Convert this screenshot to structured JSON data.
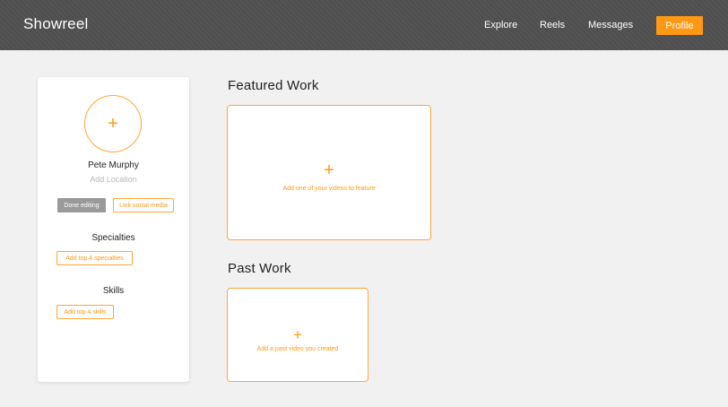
{
  "header": {
    "brand": "Showreel",
    "nav": {
      "explore": "Explore",
      "reels": "Reels",
      "messages": "Messages",
      "profile": "Profile"
    },
    "accent_color": "#ff9914",
    "background_color": "#505050"
  },
  "profile_card": {
    "avatar_icon": "plus-icon",
    "avatar_glyph": "+",
    "name": "Pete Murphy",
    "location_placeholder": "Add Location",
    "done_editing_label": "Done editing",
    "link_social_label": "Link social media",
    "specialties": {
      "heading": "Specialties",
      "button_label": "Add top 4 specialties"
    },
    "skills": {
      "heading": "Skills",
      "button_label": "Add top 4 skills"
    }
  },
  "main": {
    "featured": {
      "heading": "Featured Work",
      "plus_glyph": "+",
      "prompt": "Add one of your videos to feature"
    },
    "past": {
      "heading": "Past Work",
      "plus_glyph": "+",
      "prompt": "Add a past video you created"
    }
  }
}
